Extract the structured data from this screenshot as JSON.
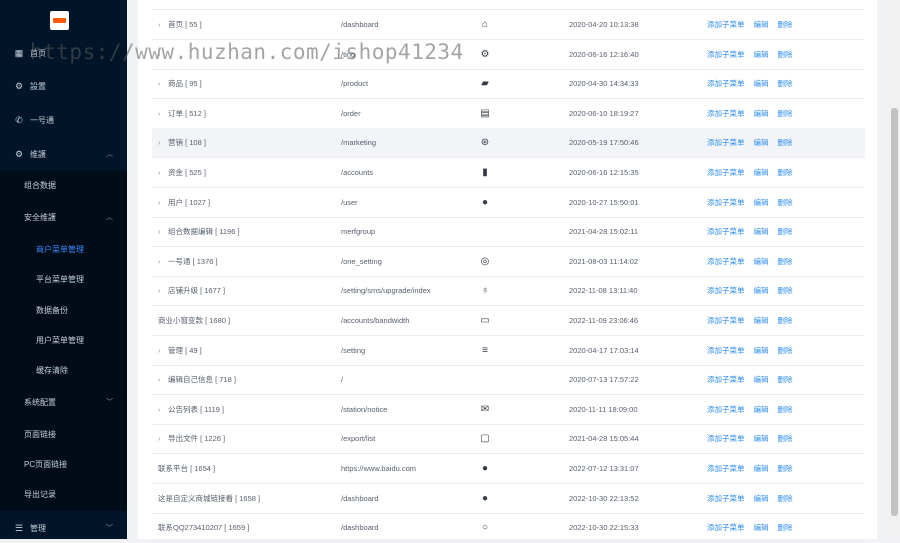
{
  "sidebar": {
    "items": [
      {
        "label": "首页",
        "icon": "grid-icon"
      },
      {
        "label": "設置",
        "icon": "gear-icon"
      },
      {
        "label": "一号通",
        "icon": "phone-icon"
      },
      {
        "label": "维護",
        "icon": "gear-icon"
      }
    ],
    "sub": [
      {
        "label": "组合数据"
      },
      {
        "label": "安全维護"
      },
      {
        "label": "商户菜单管理"
      },
      {
        "label": "平台菜单管理"
      },
      {
        "label": "数据备份"
      },
      {
        "label": "用户菜单管理"
      },
      {
        "label": "缓存清除"
      },
      {
        "label": "系统配置"
      },
      {
        "label": "页面链接"
      },
      {
        "label": "PC页面链接"
      },
      {
        "label": "导出记录"
      }
    ],
    "bottom": {
      "label": "管理",
      "icon": "sliders-icon"
    }
  },
  "table": {
    "ops": {
      "add_child": "添加子菜单",
      "edit": "编辑",
      "delete": "删除"
    },
    "rows": [
      {
        "name": "首页 [ 55 ]",
        "path": "/dashboard",
        "icon": "home-icon",
        "date": "2020-04-20 10:13:38",
        "arrow": true
      },
      {
        "name": "",
        "path": "/ting",
        "icon": "gear-icon",
        "date": "2020-06-16 12:16:40",
        "arrow": true
      },
      {
        "name": "商品 [ 95 ]",
        "path": "/product",
        "icon": "bag-icon",
        "date": "2020-04-30 14:34:33",
        "arrow": true
      },
      {
        "name": "订单 [ 512 ]",
        "path": "/order",
        "icon": "clipboard-icon",
        "date": "2020-06-10 18:19:27",
        "arrow": true
      },
      {
        "name": "营销 [ 108 ]",
        "path": "/marketing",
        "icon": "aperture-icon",
        "date": "2020-05-19 17:50:46",
        "arrow": true
      },
      {
        "name": "资金 [ 525 ]",
        "path": "/accounts",
        "icon": "bar-chart-icon",
        "date": "2020-06-16 12:15:35",
        "arrow": true
      },
      {
        "name": "用户 [ 1027 ]",
        "path": "/user",
        "icon": "user-icon",
        "date": "2020-10-27 15:50:01",
        "arrow": true
      },
      {
        "name": "组合数据编辑 [ 1196 ]",
        "path": "merfgroup",
        "icon": "",
        "date": "2021-04-28 15:02:11",
        "arrow": true
      },
      {
        "name": "一号通 [ 1376 ]",
        "path": "/one_setting",
        "icon": "headset-icon",
        "date": "2021-08-03 11:14:02",
        "arrow": true
      },
      {
        "name": "店铺升级 [ 1677 ]",
        "path": "/setting/sms/upgrade/index",
        "icon": "badge-icon",
        "date": "2022-11-08 13:11:40",
        "arrow": true
      },
      {
        "name": "商业小窗变款 [ 1680 ]",
        "path": "/accounts/bandwidth",
        "icon": "monitor-icon",
        "date": "2022-11-09 23:06:46",
        "arrow": false
      },
      {
        "name": "管理 [ 49 ]",
        "path": "/setting",
        "icon": "sliders-icon",
        "date": "2020-04-17 17:03:14",
        "arrow": true
      },
      {
        "name": "编辑自己信息 [ 718 ]",
        "path": "/",
        "icon": "",
        "date": "2020-07-13 17:57:22",
        "arrow": true
      },
      {
        "name": "公告列表 [ 1119 ]",
        "path": "/station/notice",
        "icon": "mail-icon",
        "date": "2020-11-11 18:09:00",
        "arrow": true
      },
      {
        "name": "导出文件 [ 1226 ]",
        "path": "/export/list",
        "icon": "box-icon",
        "date": "2021-04-28 15:05:44",
        "arrow": true
      },
      {
        "name": "联系平台 [ 1654 ]",
        "path": "https://www.baidu.com",
        "icon": "user-icon",
        "date": "2022-07-12 13:31:07",
        "arrow": false
      },
      {
        "name": "这是自定义商城链接看 [ 1658 ]",
        "path": "/dashboard",
        "icon": "user-icon",
        "date": "2022-10-30 22:13:52",
        "arrow": false
      },
      {
        "name": "联系QQ273410207 [ 1659 ]",
        "path": "/dashboard",
        "icon": "user-outline-icon",
        "date": "2022-10-30 22:15:33",
        "arrow": false
      }
    ]
  },
  "watermark": "https://www.huzhan.com/ishop41234"
}
